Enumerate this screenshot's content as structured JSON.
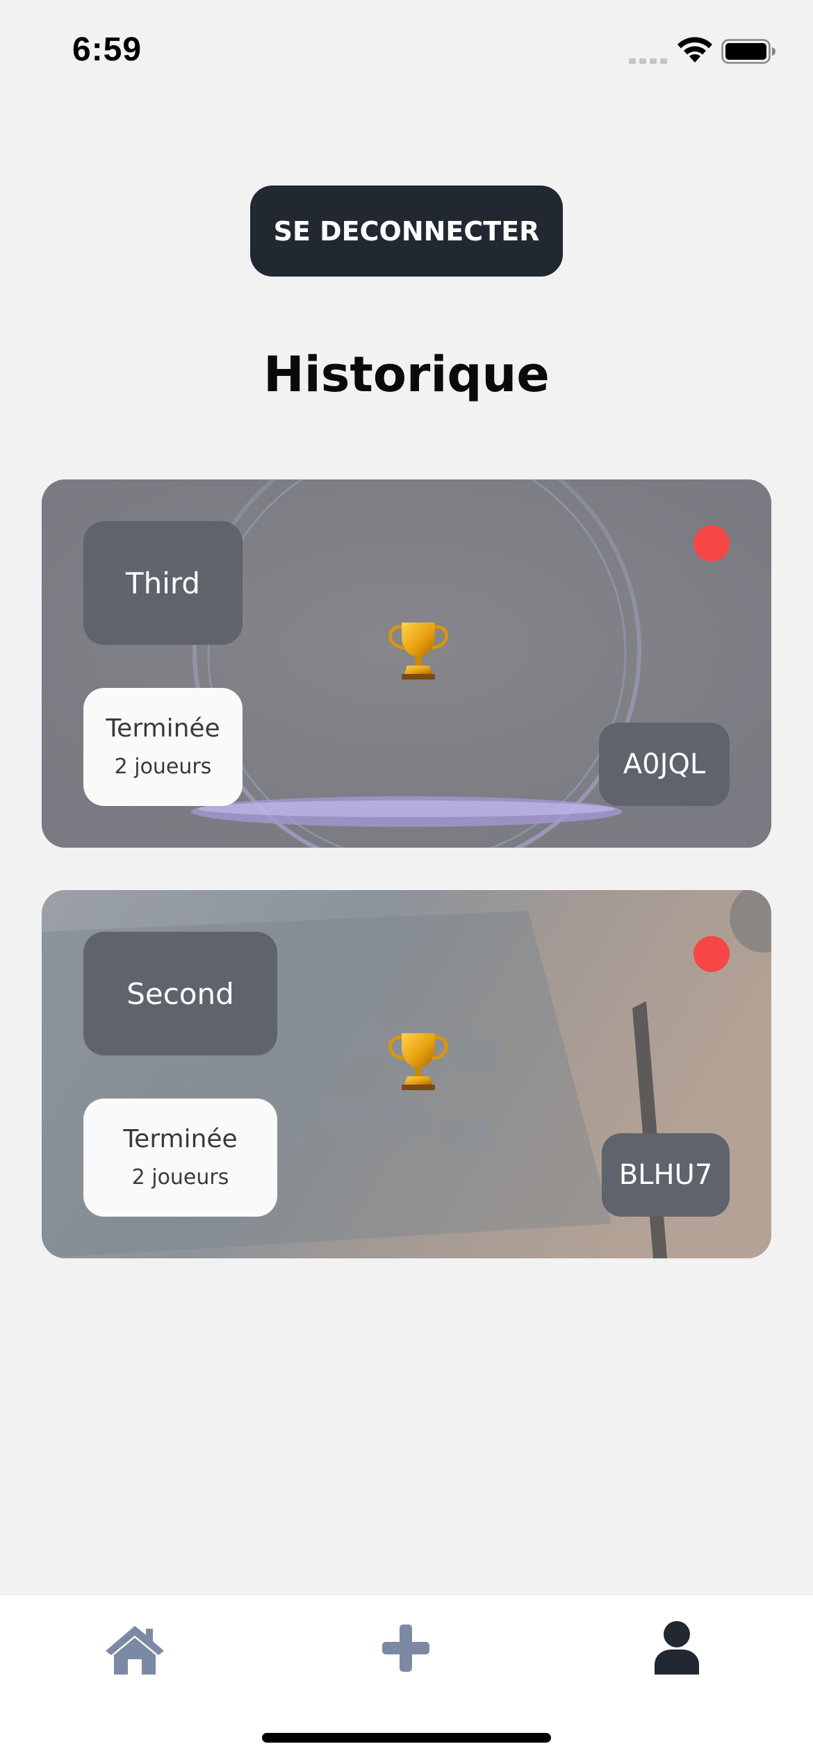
{
  "status_bar": {
    "time": "6:59"
  },
  "header": {
    "logout_label": "SE DECONNECTER",
    "title": "Historique"
  },
  "games": [
    {
      "name": "Third",
      "status": "Terminée",
      "players": "2 joueurs",
      "code": "A0JQL",
      "status_dot_color": "#f64646",
      "icon": "trophy-icon"
    },
    {
      "name": "Second",
      "status": "Terminée",
      "players": "2 joueurs",
      "code": "BLHU7",
      "status_dot_color": "#f64646",
      "icon": "trophy-icon"
    }
  ],
  "tab_bar": {
    "items": [
      {
        "icon": "home-icon",
        "active": false
      },
      {
        "icon": "plus-icon",
        "active": false
      },
      {
        "icon": "user-icon",
        "active": true
      }
    ]
  },
  "colors": {
    "primary_dark": "#222831",
    "tab_inactive": "#7b8aa3",
    "tab_active": "#222831",
    "badge_bg": "#5f636b",
    "status_dot": "#f64646",
    "page_bg": "#f2f2f2"
  }
}
